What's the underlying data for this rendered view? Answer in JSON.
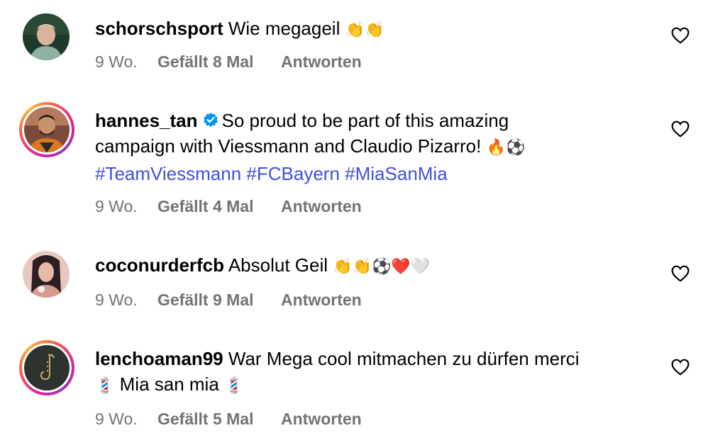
{
  "comments": [
    {
      "username": "schorschsport",
      "text_parts": [
        {
          "t": "Wie megageil "
        }
      ],
      "emoji": "👏👏",
      "time": "9 Wo.",
      "likes": "Gefällt 8 Mal",
      "reply": "Antworten"
    },
    {
      "username": "hannes_tan",
      "verified": true,
      "line1": "So proud to be part of this amazing",
      "line2": "campaign with Viessmann and Claudio Pizarro! ",
      "line2_emoji": "🔥⚽",
      "hashtags": [
        "#TeamViessmann",
        "#FCBayern",
        "#MiaSanMia"
      ],
      "time": "9 Wo.",
      "likes": "Gefällt 4 Mal",
      "reply": "Antworten"
    },
    {
      "username": "coconurderfcb",
      "text": "Absolut Geil ",
      "emoji": "👏👏⚽❤️🤍",
      "time": "9 Wo.",
      "likes": "Gefällt 9 Mal",
      "reply": "Antworten"
    },
    {
      "username": "lenchoaman99",
      "line1": "War Mega cool mitmachen zu dürfen merci",
      "line2_pre_emoji": "💈",
      "line2": " Mia san mia ",
      "line2_post_emoji": "💈",
      "time": "9 Wo.",
      "likes": "Gefällt 5 Mal",
      "reply": "Antworten"
    }
  ],
  "colors": {
    "hashtag": "#3f51d9",
    "meta": "#737373",
    "verified": "#0095f6"
  },
  "icons": {
    "like": "heart-outline-icon",
    "verified": "verified-badge-icon"
  }
}
